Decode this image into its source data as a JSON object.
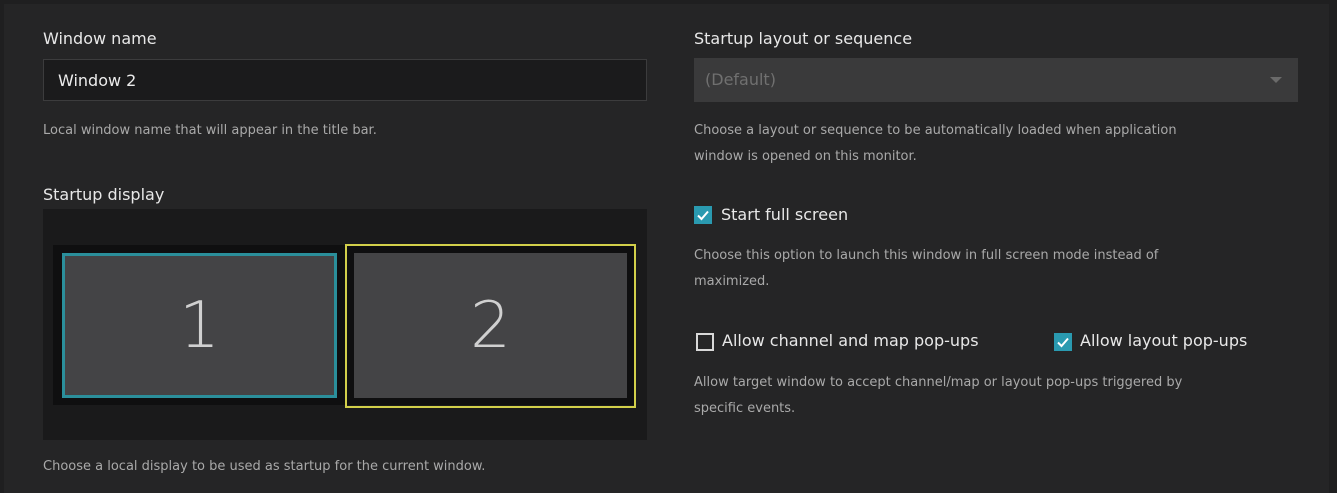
{
  "window_name": {
    "label": "Window name",
    "value": "Window 2",
    "help": "Local window name that will appear in the title bar."
  },
  "startup_display": {
    "label": "Startup display",
    "monitors": [
      "1",
      "2"
    ],
    "help": "Choose a local display to be used as startup for the current window."
  },
  "startup_layout": {
    "label": "Startup layout or sequence",
    "selected": "(Default)",
    "help_line1": "Choose a layout or sequence to be automatically loaded when application",
    "help_line2": "window is opened on this monitor."
  },
  "full_screen": {
    "label": "Start full screen",
    "checked": true,
    "help_line1": "Choose this option to launch this window in full screen mode instead of",
    "help_line2": "maximized."
  },
  "popups": {
    "channel_map_label": "Allow channel and map pop-ups",
    "channel_map_checked": false,
    "layout_label": "Allow layout pop-ups",
    "layout_checked": true,
    "help_line1": "Allow target window to accept channel/map or layout pop-ups triggered by",
    "help_line2": "specific events."
  },
  "colors": {
    "accent": "#2a9ab0",
    "selected_monitor_border": "#2b8f9b",
    "current_monitor_border": "#d2cf4a"
  }
}
